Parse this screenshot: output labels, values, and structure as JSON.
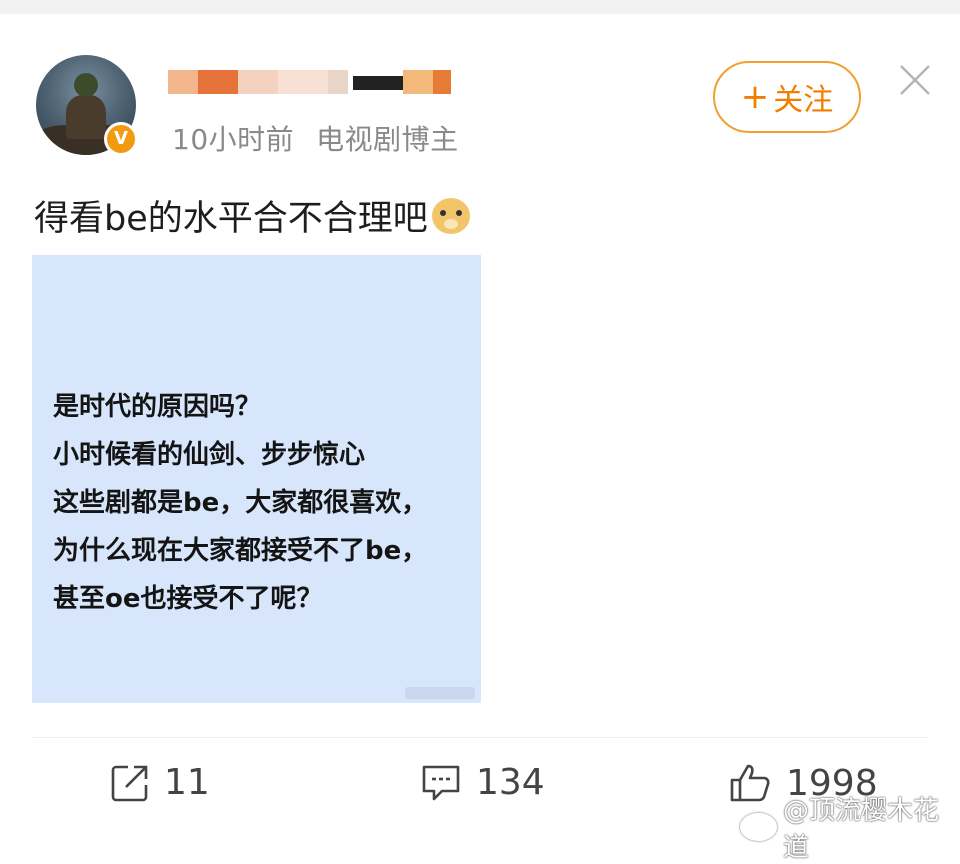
{
  "header": {
    "meta_time": "10小时前",
    "meta_role": "电视剧博主",
    "verified_badge": "V",
    "follow_plus": "+",
    "follow_label": "关注"
  },
  "post": {
    "text": "得看be的水平合不合理吧",
    "emoji": "doge-emoji",
    "image_lines": [
      "是时代的原因吗？",
      "小时候看的仙剑、步步惊心",
      "这些剧都是be，大家都很喜欢，",
      "为什么现在大家都接受不了be，",
      "甚至oe也接受不了呢？"
    ]
  },
  "actions": {
    "share_count": "11",
    "comment_count": "134",
    "like_count": "1998"
  },
  "watermark": {
    "text": "@顶流樱木花道"
  },
  "icons": {
    "share": "share-icon",
    "comment": "comment-icon",
    "like": "thumbs-up-icon",
    "close": "close-icon"
  },
  "colors": {
    "accent": "#f07f00",
    "image_bg": "#d7e6fb"
  }
}
